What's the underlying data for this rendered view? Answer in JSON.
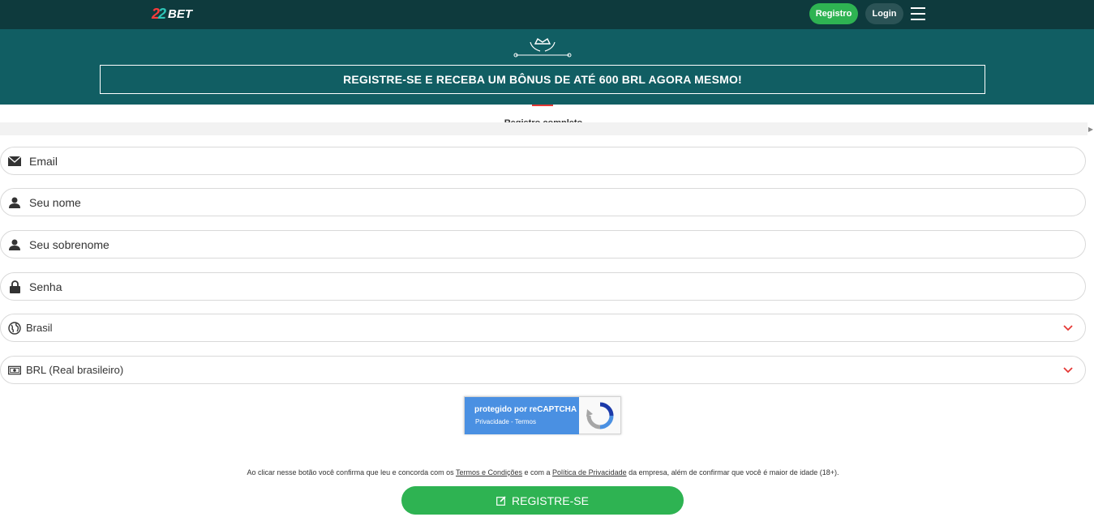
{
  "header": {
    "logo_mark_a": "2",
    "logo_mark_b": "2",
    "logo_text": "BET",
    "register_label": "Registro",
    "login_label": "Login",
    "menu_icon": "hamburger-icon",
    "colors": {
      "bar": "#0e3a3d",
      "register": "#2eb352",
      "login": "#2b5356"
    }
  },
  "banner": {
    "headline": "REGISTRE-SE E RECEBA UM BÔNUS DE ATÉ 600 BRL AGORA MESMO!",
    "icon": "crown-laurel-icon",
    "color": "#115e63"
  },
  "tabs": {
    "active_label": "Registro completo",
    "accent": "#e53935"
  },
  "form": {
    "email_placeholder": "Email",
    "name_placeholder": "Seu nome",
    "surname_placeholder": "Seu sobrenome",
    "password_placeholder": "Senha",
    "country_value": "Brasil",
    "currency_value": "BRL (Real brasileiro)"
  },
  "captcha": {
    "line1": "protegido por reCAPTCHA",
    "line2": "Privacidade - Termos",
    "color": "#4a90e2"
  },
  "footer": {
    "terms_pre": "Ao clicar nesse botão você confirma que leu e concorda com os ",
    "terms_link": "Termos e Condições",
    "terms_mid": " e com a ",
    "privacy_link": "Política de Privacidade",
    "terms_post": " da empresa, além de confirmar que você é maior de idade (18+).",
    "submit_label": "REGISTRE-SE",
    "submit_color": "#2eb352"
  }
}
